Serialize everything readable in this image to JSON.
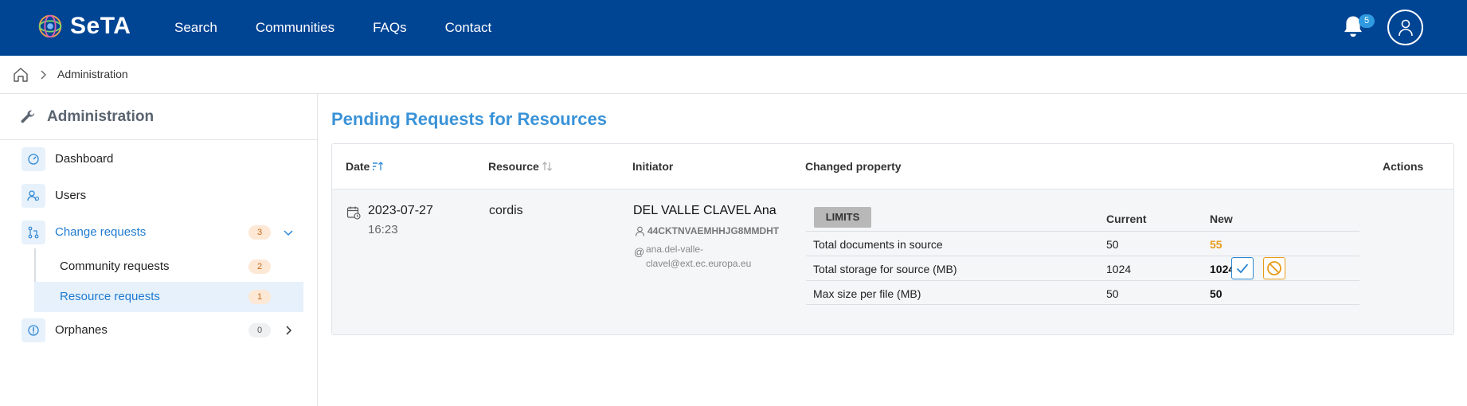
{
  "header": {
    "logo_text": "SeTA",
    "nav": [
      "Search",
      "Communities",
      "FAQs",
      "Contact"
    ],
    "notification_count": "5"
  },
  "breadcrumb": {
    "current": "Administration"
  },
  "sidebar": {
    "title": "Administration",
    "items": [
      {
        "label": "Dashboard",
        "icon": "gauge-icon"
      },
      {
        "label": "Users",
        "icon": "users-icon"
      },
      {
        "label": "Change requests",
        "icon": "pull-request-icon",
        "count": "3"
      },
      {
        "label": "Orphanes",
        "icon": "info-circle-icon",
        "count": "0"
      }
    ],
    "subitems": [
      {
        "label": "Community requests",
        "count": "2"
      },
      {
        "label": "Resource requests",
        "count": "1"
      }
    ]
  },
  "main": {
    "title": "Pending Requests for Resources",
    "columns": {
      "date": "Date",
      "resource": "Resource",
      "initiator": "Initiator",
      "changed": "Changed property",
      "actions": "Actions"
    },
    "request": {
      "date": "2023-07-27",
      "time": "16:23",
      "resource": "cordis",
      "initiator_name": "DEL VALLE CLAVEL Ana",
      "initiator_id": "44CKTNVAEMHHJG8MMDHT",
      "initiator_email": "ana.del-valle-clavel@ext.ec.europa.eu",
      "property_group": "LIMITS",
      "col_current": "Current",
      "col_new": "New",
      "properties": [
        {
          "name": "Total documents in source",
          "current": "50",
          "new": "55"
        },
        {
          "name": "Total storage for source (MB)",
          "current": "1024",
          "new": "1024"
        },
        {
          "name": "Max size per file (MB)",
          "current": "50",
          "new": "50"
        }
      ]
    }
  },
  "colors": {
    "header_bg": "#004494",
    "accent": "#3a93d8",
    "changed_value": "#e89b1a"
  }
}
